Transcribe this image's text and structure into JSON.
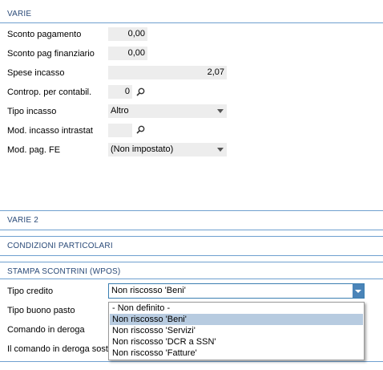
{
  "colors": {
    "section_title": "#2a4a78",
    "rule": "#6fa0cf",
    "field_bg": "#ededed",
    "selected_option_bg": "#b7cbe0",
    "active_combo_border": "#3c7fb1"
  },
  "varie": {
    "title": "VARIE",
    "sconto_pagamento": {
      "label": "Sconto pagamento",
      "value": "0,00"
    },
    "sconto_pag_finanziario": {
      "label": "Sconto pag finanziario",
      "value": "0,00"
    },
    "spese_incasso": {
      "label": "Spese incasso",
      "value": "2,07"
    },
    "contropartita": {
      "label": "Controp. per contabil.",
      "value": "0"
    },
    "tipo_incasso": {
      "label": "Tipo incasso",
      "value": "Altro"
    },
    "mod_incasso_intrastat": {
      "label": "Mod. incasso intrastat",
      "value": ""
    },
    "mod_pag_fe": {
      "label": "Mod. pag. FE",
      "value": "(Non impostato)"
    }
  },
  "varie2": {
    "title": "VARIE 2"
  },
  "condizioni": {
    "title": "CONDIZIONI PARTICOLARI"
  },
  "stampa": {
    "title": "STAMPA SCONTRINI (WPOS)",
    "tipo_credito": {
      "label": "Tipo credito",
      "value": "Non riscosso 'Beni'"
    },
    "tipo_buono_pasto": {
      "label": "Tipo buono pasto"
    },
    "comando_in_deroga": {
      "label": "Comando in deroga"
    },
    "comando_deroga_sost": {
      "label": "Il comando in deroga sosti"
    }
  },
  "dropdown": {
    "options": [
      "- Non definito -",
      "Non riscosso 'Beni'",
      "Non riscosso 'Servizi'",
      "Non riscosso 'DCR a SSN'",
      "Non riscosso 'Fatture'"
    ],
    "selected_index": 1
  }
}
